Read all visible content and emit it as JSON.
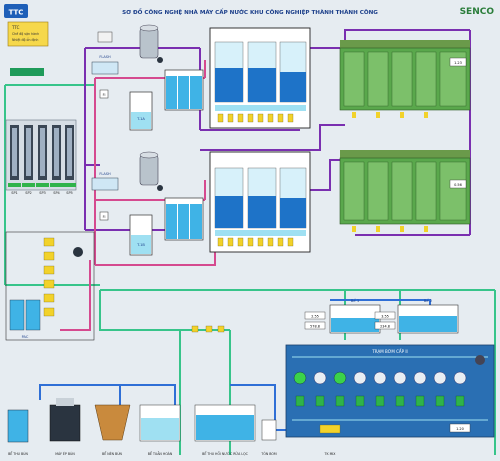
{
  "header": {
    "logo_left": "TTC",
    "title": "SƠ ĐỒ CÔNG NGHỆ NHÀ MÁY CẤP NƯỚC KHU CÔNG NGHIỆP THÀNH THÀNH CÔNG",
    "logo_right": "SENCO"
  },
  "legend": {
    "box_title": "TTC",
    "line1": "Chế độ vận hành",
    "line2": "Nhiệt độ ổn định"
  },
  "intake": {
    "pumps": [
      "SP1",
      "SP2",
      "SP3",
      "SP4",
      "SP5"
    ]
  },
  "tanks": {
    "chemical_a": "T.1A",
    "chemical_b": "T.1B",
    "flash_a": "FLASH",
    "flash_b": "FLASH",
    "fi_a": "FI",
    "fi_b": "FI",
    "pac": "PAC",
    "clean_1": "Bể 1",
    "clean_2": "Bể 2"
  },
  "bottom_labels": {
    "sludge_tank": "BỂ THU BÙN",
    "press": "MÁY ÉP BÙN",
    "thickener": "BỂ NÉN BÙN",
    "settle": "BỂ TUẦN HOÀN",
    "recycle": "BỂ THU HỒI NƯỚC RỬA LỌC",
    "sump": "TÔN BOM",
    "ro_tank": "TK MIX"
  },
  "readouts": {
    "tank1_level": "2.55",
    "tank1_flow": "578.8",
    "tank2_level": "3.55",
    "tank2_flow": "234.8",
    "filter_a": "1.23",
    "filter_b": "0.56",
    "pressure": "1.20"
  },
  "status_panel": {
    "title": "TRẠM BƠM CẤP II"
  },
  "colors": {
    "pipe_purple": "#7a2fb0",
    "pipe_pink": "#d54a8f",
    "pipe_green": "#37c48a",
    "pipe_blue": "#2f6fd6",
    "water": "#3fb3e6",
    "water_light": "#9fe0f2",
    "filter_green": "#5aa84c",
    "motor_yellow": "#f2d22a",
    "status_green": "#2fb34a",
    "panel_bg": "#2a6fb3"
  }
}
